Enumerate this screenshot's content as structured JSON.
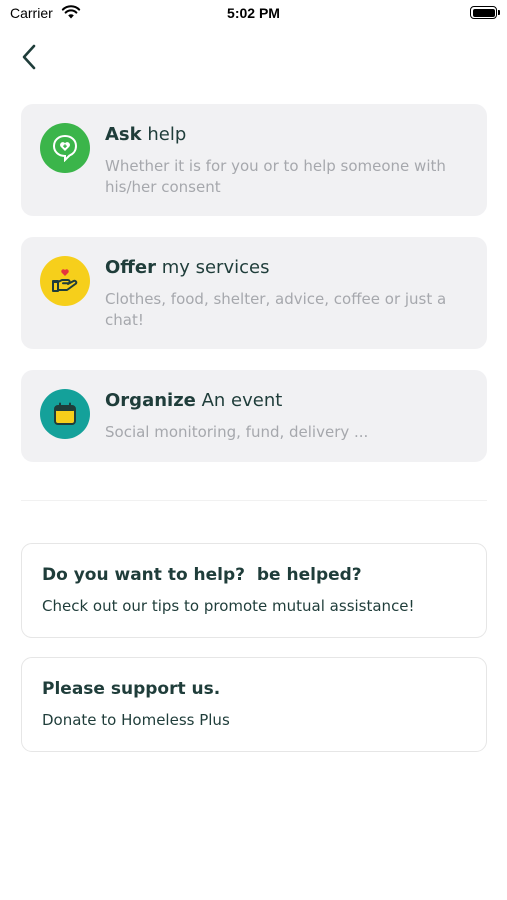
{
  "status_bar": {
    "carrier": "Carrier",
    "time": "5:02 PM"
  },
  "actions": [
    {
      "title_bold": "Ask",
      "title_rest": " help",
      "description": "Whether it is for you or to help someone with his/her consent",
      "icon": "heart-chat-icon",
      "color": "#3bb54a"
    },
    {
      "title_bold": "Offer",
      "title_rest": " my services",
      "description": "Clothes, food, shelter, advice, coffee or just a chat!",
      "icon": "hand-heart-icon",
      "color": "#f6cf1b"
    },
    {
      "title_bold": "Organize",
      "title_rest": " An event",
      "description": "Social monitoring, fund, delivery ...",
      "icon": "calendar-icon",
      "color": "#14a19a"
    }
  ],
  "tips_card": {
    "title": "Do you want to help?  be helped?",
    "subtitle": "Check out our tips to promote mutual assistance!"
  },
  "support_card": {
    "title": "Please support us.",
    "subtitle": "Donate to Homeless Plus"
  },
  "colors": {
    "primary_text": "#1f3d3a",
    "card_background": "#f1f1f3",
    "muted_text": "#a6a8ad"
  }
}
